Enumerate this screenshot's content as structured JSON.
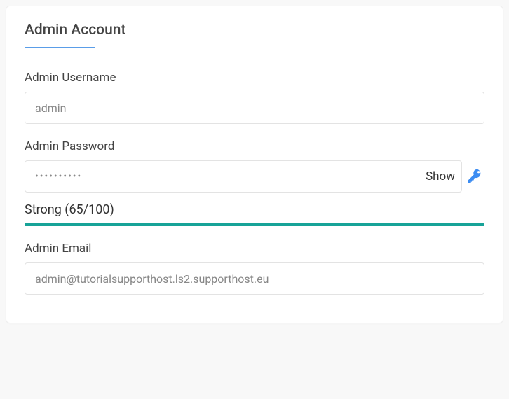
{
  "section": {
    "title": "Admin Account"
  },
  "fields": {
    "username": {
      "label": "Admin Username",
      "value": "admin"
    },
    "password": {
      "label": "Admin Password",
      "value": "••••••••••",
      "toggle_label": "Show",
      "strength_label": "Strong (65/100)"
    },
    "email": {
      "label": "Admin Email",
      "value": "admin@tutorialsupporthost.ls2.supporthost.eu"
    }
  }
}
